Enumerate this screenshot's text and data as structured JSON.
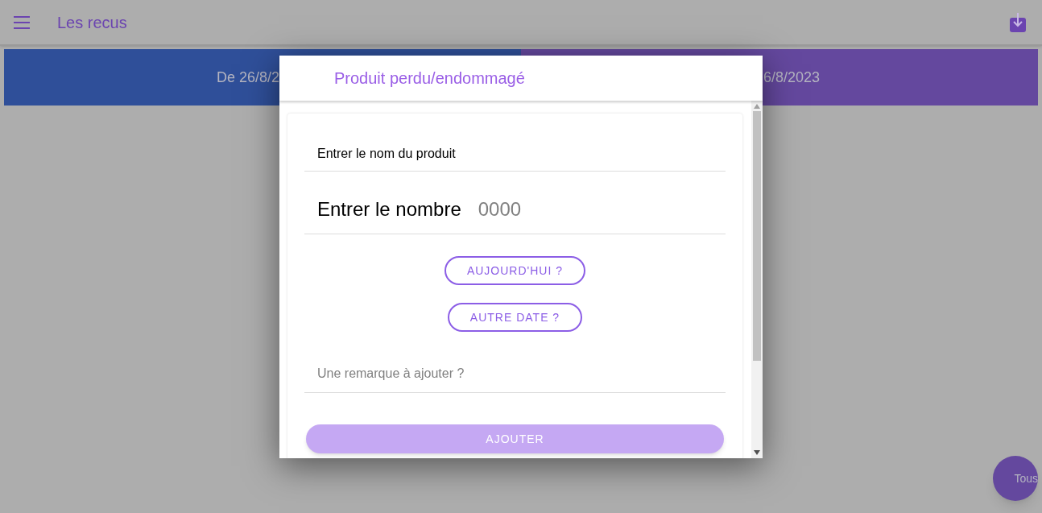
{
  "app_bar": {
    "title": "Les recus"
  },
  "date_range": {
    "from": "De 26/8/2",
    "to": "6/8/2023"
  },
  "dialog": {
    "title": "Produit perdu/endommagé",
    "name_field": {
      "placeholder": "Entrer le nom du produit"
    },
    "number_field": {
      "label": "Entrer le nombre",
      "placeholder": "0000"
    },
    "date_buttons": [
      "AUJOURD'HUI ?",
      "AUTRE DATE ?"
    ],
    "remark_field": {
      "placeholder": "Une remarque à ajouter ?"
    },
    "submit": {
      "label": "AJOUTER",
      "disabled": true
    }
  },
  "fab": {
    "label": "Tous"
  }
}
